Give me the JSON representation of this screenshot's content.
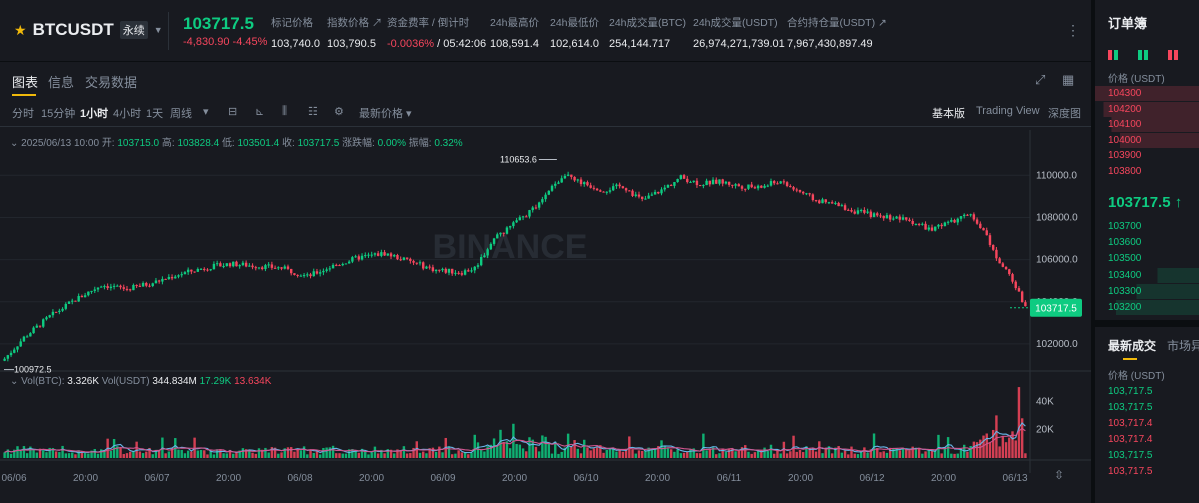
{
  "header": {
    "symbol": "BTCUSDT",
    "contract_tag": "永续",
    "last_price": "103717.5",
    "change": "-4,830.90 -4.45%",
    "stats": [
      {
        "label": "标记价格",
        "value": "103,740.0"
      },
      {
        "label": "指数价格 ↗",
        "value": "103,790.5"
      },
      {
        "label": "资金费率 / 倒计时",
        "value_neg": "-0.0036%",
        "value_rest": " / 05:42:06"
      },
      {
        "label": "24h最高价",
        "value": "108,591.4"
      },
      {
        "label": "24h最低价",
        "value": "102,614.0"
      },
      {
        "label": "24h成交量(BTC)",
        "value": "254,144.717"
      },
      {
        "label": "24h成交量(USDT)",
        "value": "26,974,271,739.01"
      },
      {
        "label": "合约持仓量(USDT) ↗",
        "value": "7,967,430,897.49"
      }
    ]
  },
  "tabs": [
    "图表",
    "信息",
    "交易数据"
  ],
  "toolbar": {
    "intervals": [
      "分时",
      "15分钟",
      "1小时",
      "4小时",
      "1天",
      "周线"
    ],
    "active_interval": "1小时",
    "price_type": "最新价格",
    "views": [
      "基本版",
      "Trading View",
      "深度图"
    ],
    "active_view": "基本版"
  },
  "ohlc": {
    "time": "2025/06/13 10:00",
    "open_label": "开:",
    "open": "103715.0",
    "high_label": "高:",
    "high": "103828.4",
    "low_label": "低:",
    "low": "103501.4",
    "close_label": "收:",
    "close": "103717.5",
    "chg_label": "涨跌幅:",
    "chg": "0.00%",
    "amp_label": "振幅:",
    "amp": "0.32%"
  },
  "volume_legend": {
    "vol_btc_label": "Vol(BTC):",
    "vol_btc": "3.326K",
    "vol_usdt_label": "Vol(USDT)",
    "vol_usdt": "344.834M",
    "ma1": "17.29K",
    "ma2": "13.634K"
  },
  "chart_data": {
    "type": "candlestick",
    "watermark": "BINANCE",
    "price_axis": [
      "110000.0",
      "108000.0",
      "106000.0",
      "104000.0",
      "102000.0"
    ],
    "y_range": [
      101000,
      111200
    ],
    "high_marker": "110653.6",
    "low_marker": "100972.5",
    "current_price": "103717.5",
    "volume_axis": [
      "40K",
      "20K"
    ],
    "time_axis": [
      "06/06",
      "20:00",
      "06/07",
      "20:00",
      "06/08",
      "20:00",
      "06/09",
      "20:00",
      "06/10",
      "20:00",
      "06/11",
      "20:00",
      "06/12",
      "20:00",
      "06/13"
    ],
    "close_path": [
      [
        0,
        101300
      ],
      [
        6,
        102300
      ],
      [
        14,
        103300
      ],
      [
        22,
        104100
      ],
      [
        30,
        104800
      ],
      [
        38,
        104600
      ],
      [
        46,
        104900
      ],
      [
        54,
        105300
      ],
      [
        62,
        105600
      ],
      [
        70,
        105800
      ],
      [
        78,
        105700
      ],
      [
        86,
        105600
      ],
      [
        94,
        105200
      ],
      [
        102,
        105700
      ],
      [
        110,
        106100
      ],
      [
        118,
        106300
      ],
      [
        126,
        105900
      ],
      [
        134,
        105500
      ],
      [
        142,
        105400
      ],
      [
        146,
        105600
      ],
      [
        152,
        107000
      ],
      [
        160,
        107900
      ],
      [
        166,
        108600
      ],
      [
        170,
        109400
      ],
      [
        174,
        110100
      ],
      [
        180,
        109600
      ],
      [
        186,
        109300
      ],
      [
        192,
        109500
      ],
      [
        198,
        108800
      ],
      [
        204,
        109300
      ],
      [
        210,
        109900
      ],
      [
        216,
        109600
      ],
      [
        222,
        109700
      ],
      [
        228,
        109500
      ],
      [
        234,
        109400
      ],
      [
        240,
        109700
      ],
      [
        246,
        109300
      ],
      [
        252,
        108800
      ],
      [
        258,
        108600
      ],
      [
        264,
        108300
      ],
      [
        270,
        108100
      ],
      [
        276,
        108000
      ],
      [
        282,
        107800
      ],
      [
        288,
        107400
      ],
      [
        294,
        107800
      ],
      [
        300,
        108100
      ],
      [
        304,
        107400
      ],
      [
        308,
        106100
      ],
      [
        312,
        105300
      ],
      [
        315,
        104400
      ],
      [
        317,
        103700
      ]
    ],
    "candle_count": 318
  },
  "orderbook": {
    "title": "订单簿",
    "price_header": "价格 (USDT)",
    "asks": [
      "104300",
      "104200",
      "104100",
      "104000",
      "103900",
      "103800"
    ],
    "mid": "103717.5 ↑",
    "bids": [
      "103700",
      "103600",
      "103500",
      "103400",
      "103300",
      "103200"
    ]
  },
  "trades": {
    "tabs": [
      "最新成交",
      "市场异"
    ],
    "price_header": "价格 (USDT)",
    "rows": [
      {
        "price": "103,717.5",
        "side": "buy"
      },
      {
        "price": "103,717.5",
        "side": "buy"
      },
      {
        "price": "103,717.4",
        "side": "sell"
      },
      {
        "price": "103,717.4",
        "side": "sell"
      },
      {
        "price": "103,717.5",
        "side": "buy"
      },
      {
        "price": "103,717.5",
        "side": "sell"
      }
    ]
  },
  "colors": {
    "up": "#0ecb81",
    "down": "#f6465d",
    "accent": "#f0b90b"
  }
}
